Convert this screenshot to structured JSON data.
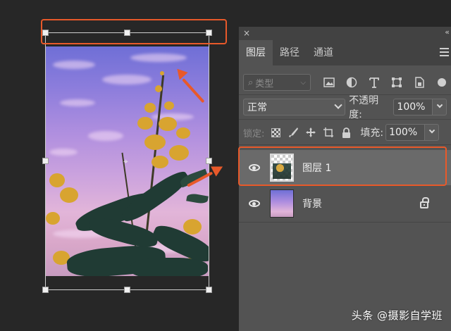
{
  "panel": {
    "close_glyph": "×",
    "collapse_glyph": "«",
    "tabs": [
      {
        "label": "图层",
        "active": true
      },
      {
        "label": "路径",
        "active": false
      },
      {
        "label": "通道",
        "active": false
      }
    ],
    "filter": {
      "placeholder": "类型",
      "search_glyph": "⌕"
    },
    "filter_icons": [
      "image-filter-icon",
      "adjustment-filter-icon",
      "type-filter-icon",
      "shape-filter-icon",
      "smart-object-filter-icon"
    ],
    "blend_mode": "正常",
    "opacity_label": "不透明度:",
    "opacity_value": "100%",
    "lock_label": "锁定:",
    "fill_label": "填充:",
    "fill_value": "100%",
    "layers": [
      {
        "name": "图层 1",
        "selected": true,
        "visible": true
      },
      {
        "name": "背景",
        "selected": false,
        "visible": true,
        "locked": true
      }
    ]
  },
  "watermark": "头条 @摄影自学班",
  "colors": {
    "annotation": "#e8592a",
    "panel_bg": "#535353",
    "canvas_bg": "#272727"
  }
}
